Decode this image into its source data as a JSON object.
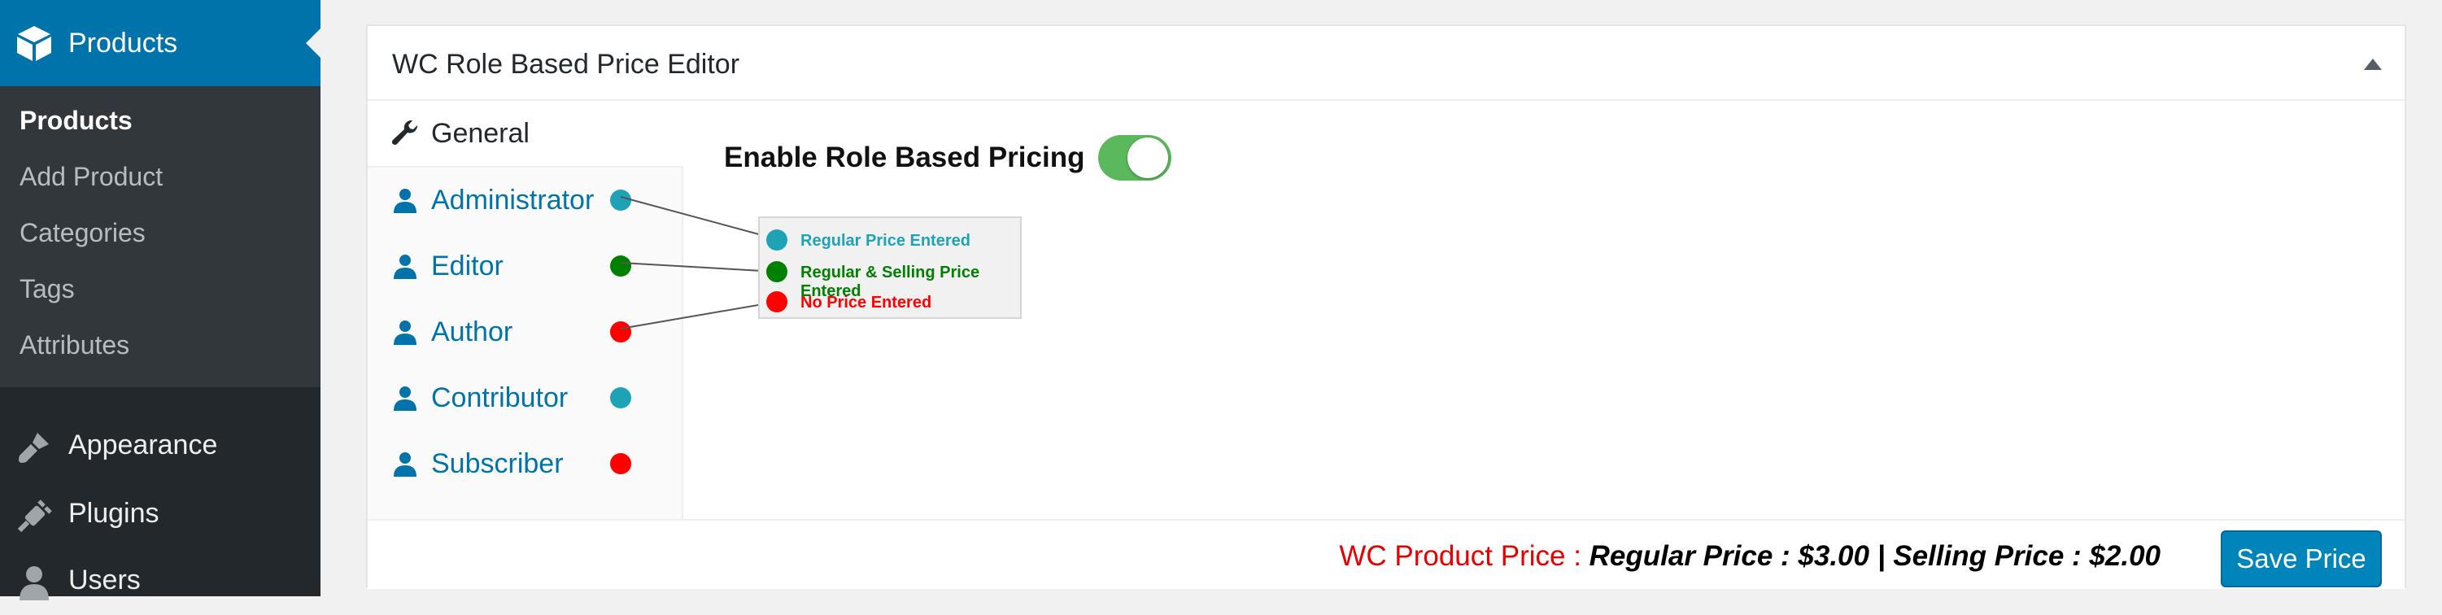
{
  "sidebar": {
    "current_menu": {
      "label": "Products",
      "icon": "box-icon"
    },
    "submenu": [
      {
        "label": "Products",
        "current": true
      },
      {
        "label": "Add Product"
      },
      {
        "label": "Categories"
      },
      {
        "label": "Tags"
      },
      {
        "label": "Attributes"
      }
    ],
    "menu": [
      {
        "label": "Appearance",
        "icon": "paintbrush-icon"
      },
      {
        "label": "Plugins",
        "icon": "plug-icon"
      },
      {
        "label": "Users",
        "icon": "user-icon"
      }
    ]
  },
  "editor": {
    "title": "WC Role Based Price Editor",
    "tabs": [
      {
        "label": "General",
        "icon": "wrench-icon",
        "active": true
      },
      {
        "label": "Administrator",
        "icon": "user-icon",
        "status_color": "#1ea3b6"
      },
      {
        "label": "Editor",
        "icon": "user-icon",
        "status_color": "#008000"
      },
      {
        "label": "Author",
        "icon": "user-icon",
        "status_color": "#ff0000"
      },
      {
        "label": "Contributor",
        "icon": "user-icon",
        "status_color": "#1ea3b6"
      },
      {
        "label": "Subscriber",
        "icon": "user-icon",
        "status_color": "#ff0000"
      }
    ],
    "enable_label": "Enable Role Based Pricing",
    "enable_toggle_on": true,
    "legend": [
      {
        "label": "Regular Price Entered",
        "color": "#1ea3b6"
      },
      {
        "label": "Regular & Selling Price Entered",
        "color": "#008000"
      },
      {
        "label": "No Price Entered",
        "color": "#ff0000"
      }
    ],
    "footer": {
      "price_prefix": "WC Product Price : ",
      "price_details": "Regular Price : $3.00 | Selling Price : $2.00",
      "save_label": "Save Price"
    }
  },
  "colors": {
    "sidebar_bg": "#23282d",
    "accent": "#0073aa",
    "button": "#0085ba",
    "toggle_on": "#5cb85c"
  }
}
